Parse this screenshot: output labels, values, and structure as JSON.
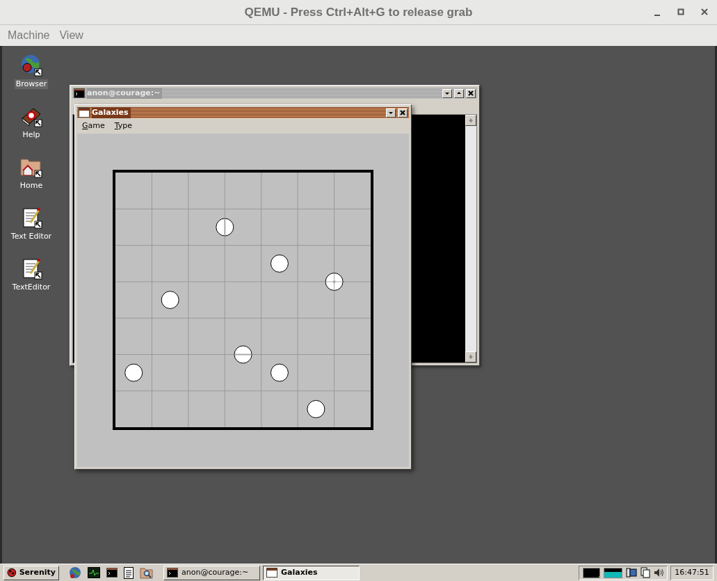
{
  "host_window": {
    "title": "QEMU - Press Ctrl+Alt+G to release grab",
    "menu": [
      "Machine",
      "View"
    ]
  },
  "desktop_icons": [
    {
      "kind": "browser",
      "label": "Browser",
      "selected": true
    },
    {
      "kind": "help",
      "label": "Help",
      "selected": false
    },
    {
      "kind": "home",
      "label": "Home",
      "selected": false
    },
    {
      "kind": "editor",
      "label": "Text Editor",
      "selected": false
    },
    {
      "kind": "editor",
      "label": "TextEditor",
      "selected": false
    }
  ],
  "terminal_window": {
    "title": "anon@courage:~"
  },
  "galaxies_window": {
    "title": "Galaxies",
    "menu": [
      "Game",
      "Type"
    ],
    "board_rows": [
      {
        "cells": [
          {
            "kind": "empty"
          },
          {
            "kind": "empty"
          },
          {
            "kind": "empty"
          },
          {
            "kind": "empty"
          },
          {
            "kind": "empty"
          },
          {
            "kind": "empty"
          },
          {
            "kind": "empty"
          }
        ]
      },
      {
        "cells": [
          {
            "kind": "empty"
          },
          {
            "kind": "empty"
          },
          {
            "kind": "sidedot"
          },
          {
            "kind": "empty"
          },
          {
            "kind": "empty"
          },
          {
            "kind": "empty"
          },
          {
            "kind": "empty"
          }
        ]
      },
      {
        "cells": [
          {
            "kind": "empty"
          },
          {
            "kind": "empty"
          },
          {
            "kind": "empty"
          },
          {
            "kind": "empty"
          },
          {
            "kind": "dot"
          },
          {
            "kind": "cornerdot"
          },
          {
            "kind": "empty"
          }
        ]
      },
      {
        "cells": [
          {
            "kind": "empty"
          },
          {
            "kind": "dot"
          },
          {
            "kind": "empty"
          },
          {
            "kind": "empty"
          },
          {
            "kind": "empty"
          },
          {
            "kind": "empty"
          },
          {
            "kind": "empty"
          }
        ]
      },
      {
        "cells": [
          {
            "kind": "empty"
          },
          {
            "kind": "empty"
          },
          {
            "kind": "empty"
          },
          {
            "kind": "lowdot"
          },
          {
            "kind": "empty"
          },
          {
            "kind": "empty"
          },
          {
            "kind": "empty"
          }
        ]
      },
      {
        "cells": [
          {
            "kind": "dot"
          },
          {
            "kind": "empty"
          },
          {
            "kind": "empty"
          },
          {
            "kind": "empty"
          },
          {
            "kind": "dot"
          },
          {
            "kind": "empty"
          },
          {
            "kind": "empty"
          }
        ]
      },
      {
        "cells": [
          {
            "kind": "empty"
          },
          {
            "kind": "empty"
          },
          {
            "kind": "empty"
          },
          {
            "kind": "empty"
          },
          {
            "kind": "empty"
          },
          {
            "kind": "dot"
          },
          {
            "kind": "empty"
          }
        ]
      }
    ]
  },
  "taskbar": {
    "start": "Serenity",
    "quick_launch": [
      {
        "kind": "browser"
      },
      {
        "kind": "monitor"
      },
      {
        "kind": "terminal"
      },
      {
        "kind": "notes"
      },
      {
        "kind": "files"
      }
    ],
    "tasks": [
      {
        "kind": "terminal",
        "title": "anon@courage:~",
        "selected": false
      },
      {
        "kind": "window",
        "title": "Galaxies",
        "selected": true
      }
    ],
    "clock": "16:47:51"
  }
}
